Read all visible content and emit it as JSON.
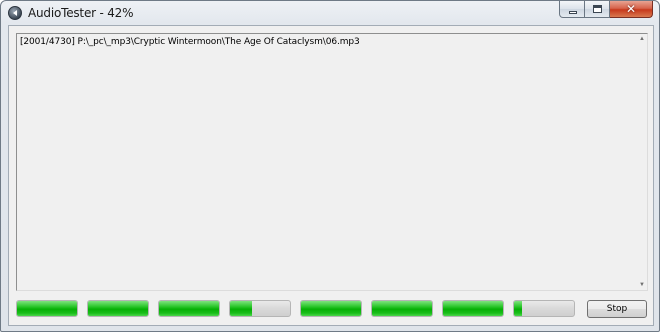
{
  "window": {
    "title": "AudioTester - 42%",
    "icon": "speaker-icon"
  },
  "caption_buttons": {
    "minimize_icon": "minimize-icon",
    "maximize_icon": "maximize-icon",
    "close_icon": "close-icon",
    "close_glyph": "✕",
    "close_color": "#c7391c"
  },
  "log": {
    "lines": [
      "[2001/4730]  P:\\_pc\\_mp3\\Cryptic Wintermoon\\The Age Of Cataclysm\\06.mp3"
    ]
  },
  "scrollbar": {
    "up_glyph": "▲",
    "down_glyph": "▼"
  },
  "progress_bars": [
    {
      "fill": 1.0
    },
    {
      "fill": 1.0
    },
    {
      "fill": 1.0
    },
    {
      "fill": 0.37
    },
    {
      "fill": 1.0
    },
    {
      "fill": 1.0
    },
    {
      "fill": 1.0
    },
    {
      "fill": 0.13
    }
  ],
  "progress_color": "#06b006",
  "stop_button": {
    "label": "Stop"
  }
}
